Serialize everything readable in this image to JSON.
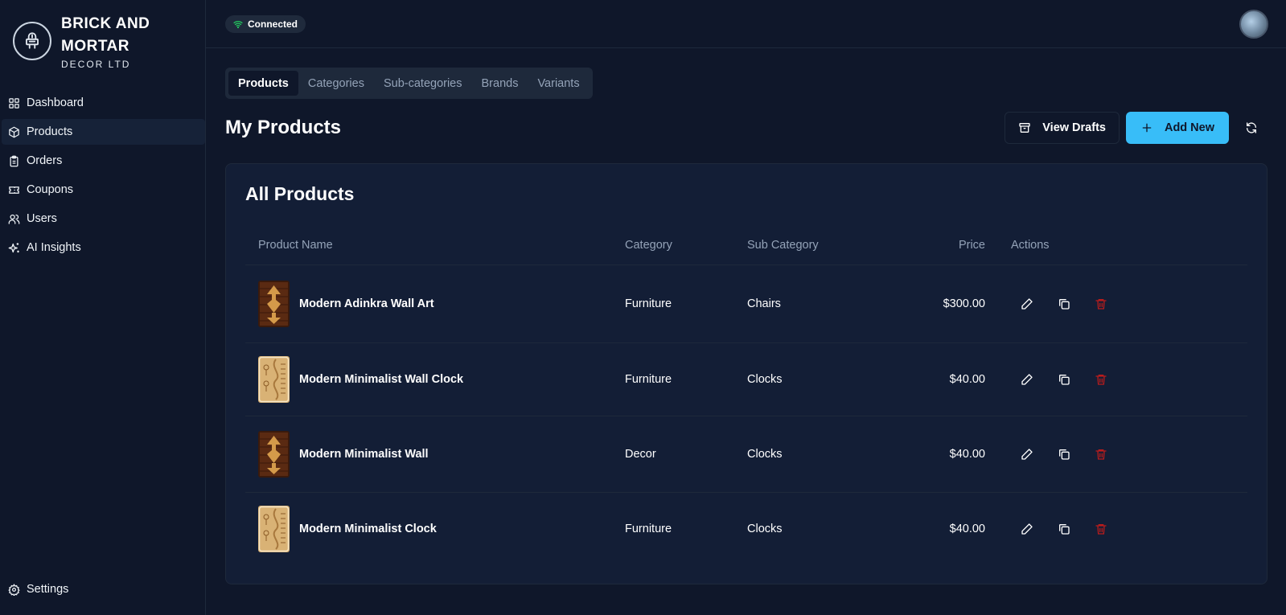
{
  "brand": {
    "name_line1": "BRICK AND",
    "name_line2": "MORTAR",
    "sub": "DECOR LTD",
    "logo_icon": "plug-icon"
  },
  "sidebar": {
    "items": [
      {
        "label": "Dashboard",
        "icon": "grid-icon",
        "active": false
      },
      {
        "label": "Products",
        "icon": "box-icon",
        "active": true
      },
      {
        "label": "Orders",
        "icon": "clipboard-icon",
        "active": false
      },
      {
        "label": "Coupons",
        "icon": "ticket-icon",
        "active": false
      },
      {
        "label": "Users",
        "icon": "users-icon",
        "active": false
      },
      {
        "label": "AI Insights",
        "icon": "sparkles-icon",
        "active": false
      }
    ],
    "settings_label": "Settings"
  },
  "topbar": {
    "status": "Connected",
    "status_color": "#22c55e"
  },
  "tabs": [
    {
      "label": "Products",
      "active": true
    },
    {
      "label": "Categories",
      "active": false
    },
    {
      "label": "Sub-categories",
      "active": false
    },
    {
      "label": "Brands",
      "active": false
    },
    {
      "label": "Variants",
      "active": false
    }
  ],
  "header": {
    "title": "My Products",
    "view_drafts_label": "View Drafts",
    "add_new_label": "Add New"
  },
  "card": {
    "title": "All Products",
    "columns": [
      "Product Name",
      "Category",
      "Sub Category",
      "Price",
      "Actions"
    ]
  },
  "products": [
    {
      "name": "Modern Adinkra Wall Art",
      "category": "Furniture",
      "sub_category": "Chairs",
      "price": "$300.00",
      "thumb": "dark-wood"
    },
    {
      "name": "Modern Minimalist Wall Clock",
      "category": "Furniture",
      "sub_category": "Clocks",
      "price": "$40.00",
      "thumb": "light-wood"
    },
    {
      "name": "Modern Minimalist Wall",
      "category": "Decor",
      "sub_category": "Clocks",
      "price": "$40.00",
      "thumb": "dark-wood"
    },
    {
      "name": "Modern Minimalist Clock",
      "category": "Furniture",
      "sub_category": "Clocks",
      "price": "$40.00",
      "thumb": "light-wood"
    }
  ],
  "colors": {
    "background": "#0f172a",
    "card": "#131e36",
    "accent": "#38bdf8",
    "danger": "#b91c1c"
  }
}
